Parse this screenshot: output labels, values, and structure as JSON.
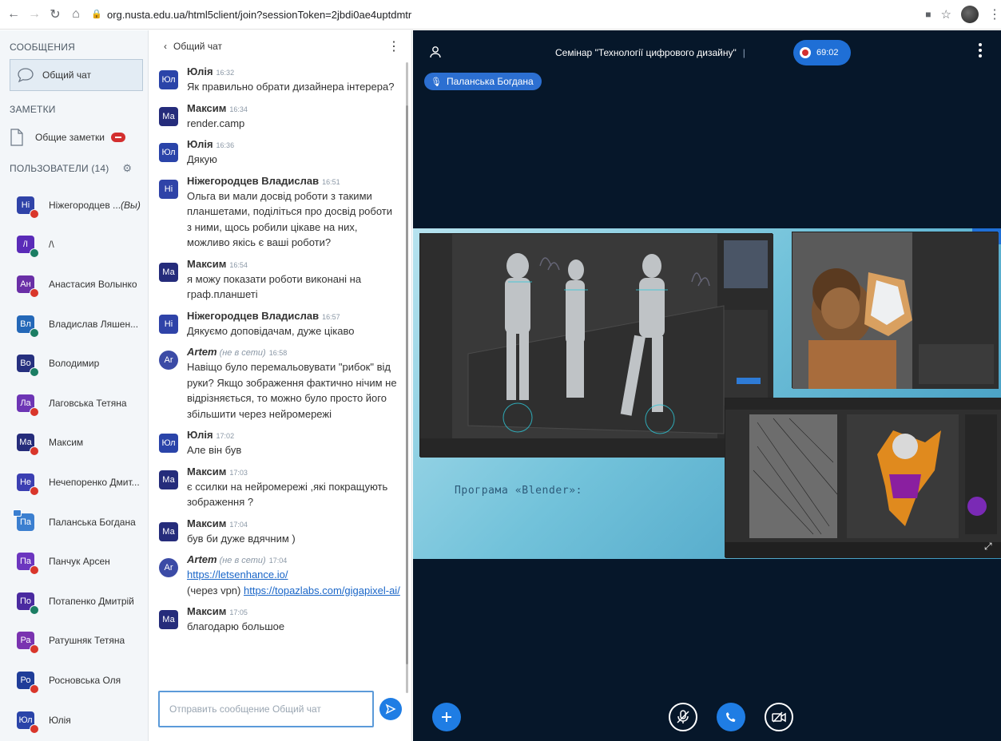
{
  "browser": {
    "url": "org.nusta.edu.ua/html5client/join?sessionToken=2jbdi0ae4uptdmtr"
  },
  "sidebar": {
    "messages_title": "СООБЩЕНИЯ",
    "public_chat_label": "Общий чат",
    "notes_title": "ЗАМЕТКИ",
    "shared_notes_label": "Общие заметки",
    "users_title": "ПОЛЬЗОВАТЕЛИ (14)",
    "users": [
      {
        "initials": "Ні",
        "name": "Ніжегородцев ...",
        "you": "(Вы)",
        "color": "#2f43a8",
        "status": "muted"
      },
      {
        "initials": "/I",
        "name": "/\\",
        "color": "#5a2bb8",
        "status": "listen"
      },
      {
        "initials": "Ан",
        "name": "Анастасия Волынко",
        "color": "#6a2fa7",
        "status": "muted"
      },
      {
        "initials": "Вл",
        "name": "Владислав Ляшен...",
        "color": "#2468b8",
        "status": "listen"
      },
      {
        "initials": "Во",
        "name": "Володимир",
        "color": "#26307f",
        "status": "listen"
      },
      {
        "initials": "Ла",
        "name": "Лаговська Тетяна",
        "color": "#6d35b5",
        "status": "muted"
      },
      {
        "initials": "Ма",
        "name": "Максим",
        "color": "#252c7b",
        "status": "muted"
      },
      {
        "initials": "Не",
        "name": "Нечепоренко Дмит...",
        "color": "#3b3fb2",
        "status": "muted"
      },
      {
        "initials": "Па",
        "name": "Паланська Богдана",
        "color": "#3b7fd0",
        "status": "presenter"
      },
      {
        "initials": "Па",
        "name": "Панчук Арсен",
        "color": "#6c36bf",
        "status": "muted"
      },
      {
        "initials": "По",
        "name": "Потапенко Дмитрій",
        "color": "#4a2aa0",
        "status": "listen"
      },
      {
        "initials": "Ра",
        "name": "Ратушняк Тетяна",
        "color": "#7a33b0",
        "status": "muted"
      },
      {
        "initials": "Ро",
        "name": "Росновська Оля",
        "color": "#1f3d99",
        "status": "muted"
      },
      {
        "initials": "Юл",
        "name": "Юлія",
        "color": "#2a44a9",
        "status": "muted"
      }
    ]
  },
  "chat": {
    "header_title": "Общий чат",
    "input_placeholder": "Отправить сообщение Общий чат",
    "messages": [
      {
        "initials": "Юл",
        "color": "#2a44a9",
        "name": "Юлія",
        "time": "16:32",
        "lines": [
          "Як правильно обрати дизайнера інтерера?"
        ]
      },
      {
        "initials": "Ма",
        "color": "#252c7b",
        "name": "Максим",
        "time": "16:34",
        "lines": [
          "render.camp"
        ]
      },
      {
        "initials": "Юл",
        "color": "#2a44a9",
        "name": "Юлія",
        "time": "16:36",
        "lines": [
          "Дякую"
        ]
      },
      {
        "initials": "Ні",
        "color": "#2f43a8",
        "name": "Ніжегородцев Владислав",
        "time": "16:51",
        "lines": [
          "Ольга ви мали досвід роботи з такими",
          "планшетами, поділіться про досвід роботи",
          "з ними, щось робили цікаве на них,",
          "можливо якісь є ваші роботи?"
        ]
      },
      {
        "initials": "Ма",
        "color": "#252c7b",
        "name": "Максим",
        "time": "16:54",
        "lines": [
          "я можу показати роботи виконані на",
          "граф.планшеті"
        ]
      },
      {
        "initials": "Ні",
        "color": "#2f43a8",
        "name": "Ніжегородцев Владислав",
        "time": "16:57",
        "lines": [
          "Дякуємо доповідачам, дуже цікаво"
        ]
      },
      {
        "initials": "Ar",
        "color": "#3b4ba6",
        "round": true,
        "name": "Artem",
        "offline": "(не в сети)",
        "time": "16:58",
        "lines": [
          "Навіщо було перемальовувати \"рибок\" від",
          "руки? Якщо зображення фактично нічим не",
          "відрізняється, то можно було просто його",
          "збільшити через нейромережі"
        ]
      },
      {
        "initials": "Юл",
        "color": "#2a44a9",
        "name": "Юлія",
        "time": "17:02",
        "lines": [
          "Але він був"
        ]
      },
      {
        "initials": "Ма",
        "color": "#252c7b",
        "name": "Максим",
        "time": "17:03",
        "lines": [
          "є ссилки на нейромережі ,які покращують",
          "зображення ?"
        ]
      },
      {
        "initials": "Ма",
        "color": "#252c7b",
        "name": "Максим",
        "time": "17:04",
        "lines": [
          "був би дуже вдячним )"
        ]
      },
      {
        "initials": "Ar",
        "color": "#3b4ba6",
        "round": true,
        "name": "Artem",
        "offline": "(не в сети)",
        "time": "17:04",
        "link1": "https://letsenhance.io/",
        "prefix2": "(через vpn) ",
        "link2": "https://topazlabs.com/gigapixel-ai/"
      },
      {
        "initials": "Ма",
        "color": "#252c7b",
        "name": "Максим",
        "time": "17:05",
        "lines": [
          "благодарю большое"
        ]
      }
    ]
  },
  "main": {
    "meeting_title": "Семінар \"Технології цифрового дизайну\"",
    "recording_time": "69:02",
    "talker": "Паланська Богдана",
    "slide_caption": "Програма «Blender»:"
  }
}
